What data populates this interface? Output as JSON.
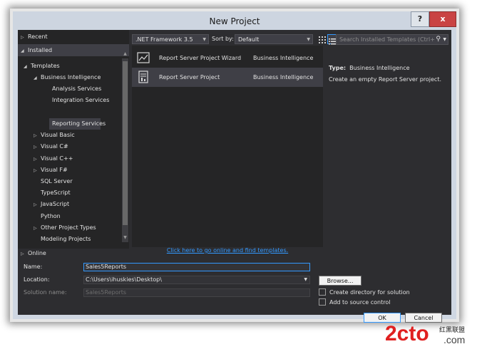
{
  "window": {
    "title": "New Project",
    "help_label": "?",
    "close_label": "x"
  },
  "tree": {
    "recent": "Recent",
    "installed": "Installed",
    "templates": "Templates",
    "business_intelligence": "Business Intelligence",
    "analysis_services": "Analysis Services",
    "integration_services": "Integration Services",
    "reporting_services": "Reporting Services",
    "visual_basic": "Visual Basic",
    "visual_csharp": "Visual C#",
    "visual_cpp": "Visual C++",
    "visual_fsharp": "Visual F#",
    "sql_server": "SQL Server",
    "typescript": "TypeScript",
    "javascript": "JavaScript",
    "python": "Python",
    "other_project_types": "Other Project Types",
    "modeling_projects": "Modeling Projects",
    "online": "Online"
  },
  "toolbar": {
    "framework": ".NET Framework 3.5",
    "sort_by_label": "Sort by:",
    "sort_by_value": "Default",
    "search_placeholder": "Search Installed Templates (Ctrl+"
  },
  "templates_list": [
    {
      "name": "Report Server Project Wizard",
      "category": "Business Intelligence"
    },
    {
      "name": "Report Server Project",
      "category": "Business Intelligence"
    }
  ],
  "online_link": "Click here to go online and find templates.",
  "description": {
    "type_label": "Type:",
    "type_value": "Business Intelligence",
    "text": "Create an empty Report Server project."
  },
  "form": {
    "name_label": "Name:",
    "name_value": "Sales5Reports",
    "location_label": "Location:",
    "location_value": "C:\\Users\\ihuskies\\Desktop\\",
    "solution_label": "Solution name:",
    "solution_value": "Sales5Reports",
    "browse_label": "Browse...",
    "create_dir_label": "Create directory for solution",
    "add_source_label": "Add to source control",
    "ok_label": "OK",
    "cancel_label": "Cancel"
  },
  "watermark": {
    "brand": "2cto",
    "suffix": ".com",
    "cn_text": "红黑联盟"
  },
  "colors": {
    "accent": "#3399ff",
    "background": "#2d2d30",
    "panel": "#252526",
    "selection": "#3f3f46",
    "watermark_red": "#e02020"
  }
}
